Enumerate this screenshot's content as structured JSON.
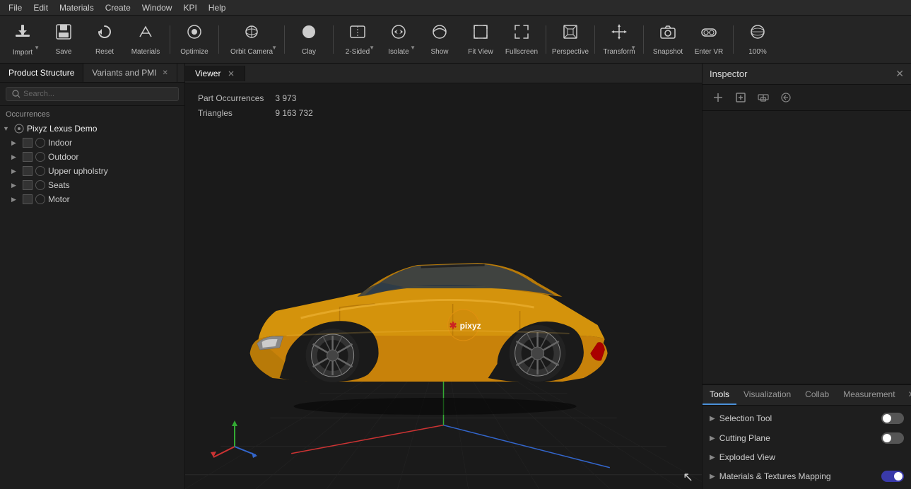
{
  "menubar": {
    "items": [
      "File",
      "Edit",
      "Materials",
      "Create",
      "Window",
      "KPI",
      "Help"
    ]
  },
  "toolbar": {
    "buttons": [
      {
        "id": "import",
        "label": "Import",
        "icon": "⬆",
        "hasArrow": true
      },
      {
        "id": "save",
        "label": "Save",
        "icon": "💾",
        "hasArrow": false
      },
      {
        "id": "reset",
        "label": "Reset",
        "icon": "↻",
        "hasArrow": false
      },
      {
        "id": "materials",
        "label": "Materials",
        "icon": "✎",
        "hasArrow": false
      },
      {
        "id": "optimize",
        "label": "Optimize",
        "icon": "⊙",
        "hasArrow": false
      },
      {
        "id": "orbit-camera",
        "label": "Orbit Camera",
        "icon": "◎",
        "hasArrow": true
      },
      {
        "id": "clay",
        "label": "Clay",
        "icon": "●",
        "hasArrow": false
      },
      {
        "id": "2sided",
        "label": "2-Sided",
        "icon": "⬡",
        "hasArrow": true
      },
      {
        "id": "isolate",
        "label": "Isolate",
        "icon": "👁",
        "hasArrow": true
      },
      {
        "id": "show",
        "label": "Show",
        "icon": "◑",
        "hasArrow": false
      },
      {
        "id": "fit-view",
        "label": "Fit View",
        "icon": "⊡",
        "hasArrow": false
      },
      {
        "id": "fullscreen",
        "label": "Fullscreen",
        "icon": "⤢",
        "hasArrow": false
      },
      {
        "id": "perspective",
        "label": "Perspective",
        "icon": "◻",
        "hasArrow": false
      },
      {
        "id": "transform",
        "label": "Transform",
        "icon": "⇔",
        "hasArrow": true
      },
      {
        "id": "snapshot",
        "label": "Snapshot",
        "icon": "📷",
        "hasArrow": false
      },
      {
        "id": "enter-vr",
        "label": "Enter VR",
        "icon": "🥽",
        "hasArrow": false
      },
      {
        "id": "zoom",
        "label": "100%",
        "icon": "🌐",
        "hasArrow": false
      }
    ]
  },
  "left_panel": {
    "tabs": [
      {
        "id": "product-structure",
        "label": "Product Structure",
        "active": true,
        "closeable": false
      },
      {
        "id": "variants-pmi",
        "label": "Variants and PMI",
        "active": false,
        "closeable": true
      }
    ],
    "search_placeholder": "Search...",
    "occurrences_label": "Occurrences",
    "tree": [
      {
        "id": "root",
        "label": "Pixyz Lexus Demo",
        "level": 0,
        "expanded": true,
        "has_expand": true
      },
      {
        "id": "indoor",
        "label": "Indoor",
        "level": 1,
        "expanded": false,
        "has_expand": true
      },
      {
        "id": "outdoor",
        "label": "Outdoor",
        "level": 1,
        "expanded": false,
        "has_expand": true
      },
      {
        "id": "upper-upholstery",
        "label": "Upper upholstry",
        "level": 1,
        "expanded": false,
        "has_expand": true
      },
      {
        "id": "seats",
        "label": "Seats",
        "level": 1,
        "expanded": false,
        "has_expand": true
      },
      {
        "id": "motor",
        "label": "Motor",
        "level": 1,
        "expanded": false,
        "has_expand": true
      }
    ]
  },
  "viewer": {
    "tab_label": "Viewer",
    "part_occurrences_label": "Part Occurrences",
    "part_occurrences_value": "3 973",
    "triangles_label": "Triangles",
    "triangles_value": "9 163 732"
  },
  "inspector": {
    "title": "Inspector",
    "tools_buttons": [
      "+",
      "+",
      "⊞",
      "↩"
    ]
  },
  "tools_panel": {
    "tabs": [
      "Tools",
      "Visualization",
      "Collab",
      "Measurement"
    ],
    "active_tab": "Tools",
    "items": [
      {
        "id": "selection-tool",
        "label": "Selection Tool",
        "has_toggle": true,
        "toggle_on": false
      },
      {
        "id": "cutting-plane",
        "label": "Cutting Plane",
        "has_toggle": true,
        "toggle_on": false
      },
      {
        "id": "exploded-view",
        "label": "Exploded View",
        "has_toggle": false
      },
      {
        "id": "materials-textures",
        "label": "Materials & Textures Mapping",
        "has_toggle": true,
        "toggle_on": true
      }
    ]
  },
  "colors": {
    "accent": "#4a4aff",
    "background": "#1e1e1e",
    "panel_bg": "#252525",
    "border": "#111111",
    "text_primary": "#cccccc",
    "text_secondary": "#888888"
  }
}
